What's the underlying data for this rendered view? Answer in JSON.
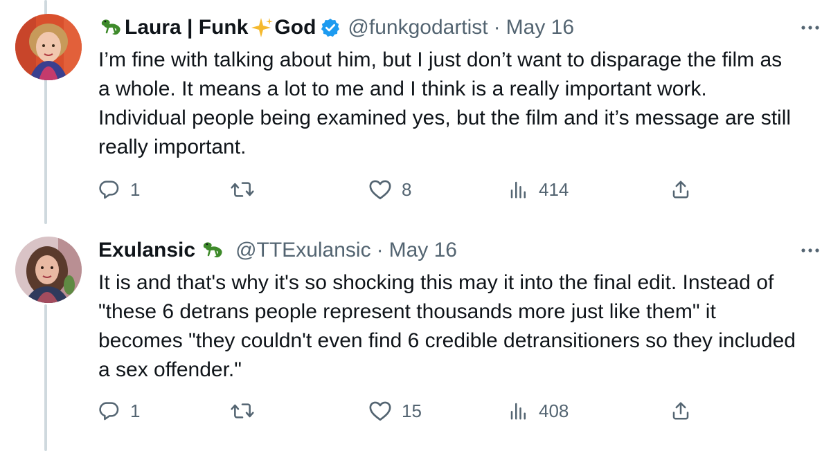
{
  "tweets": [
    {
      "name": "Laura | Funk",
      "name_suffix": "God",
      "handle": "@funkgodartist",
      "separator": "·",
      "date": "May 16",
      "text": "I’m fine with talking about him, but I just don’t want to disparage the film as a whole. It means a lot to me and I think is a really important work. Individual people being examined yes, but the film and it’s message are still really important.",
      "replies": "1",
      "retweets": "",
      "likes": "8",
      "views": "414",
      "icons": [
        "lizard-emoji-icon",
        "sparkles-emoji-icon",
        "verified-badge-icon",
        "more-options-icon",
        "reply-icon",
        "retweet-icon",
        "like-icon",
        "views-icon",
        "share-icon"
      ]
    },
    {
      "name": "Exulansic",
      "handle": "@TTExulansic",
      "separator": "·",
      "date": "May 16",
      "text": "It is and that's why it's so shocking this may it into the final edit. Instead of \"these 6 detrans people represent thousands more just like them\" it becomes \"they couldn't even find 6 credible detransitioners so they included a sex offender.\"",
      "replies": "1",
      "retweets": "",
      "likes": "15",
      "views": "408",
      "icons": [
        "lizard-emoji-icon",
        "more-options-icon",
        "reply-icon",
        "retweet-icon",
        "like-icon",
        "views-icon",
        "share-icon"
      ]
    }
  ],
  "colors": {
    "text": "#0f1419",
    "secondary": "#536471",
    "verified": "#1d9bf0",
    "thread_line": "#cfd9de",
    "lizard": "#3e8a2a",
    "sparkle": "#f5b92e"
  }
}
